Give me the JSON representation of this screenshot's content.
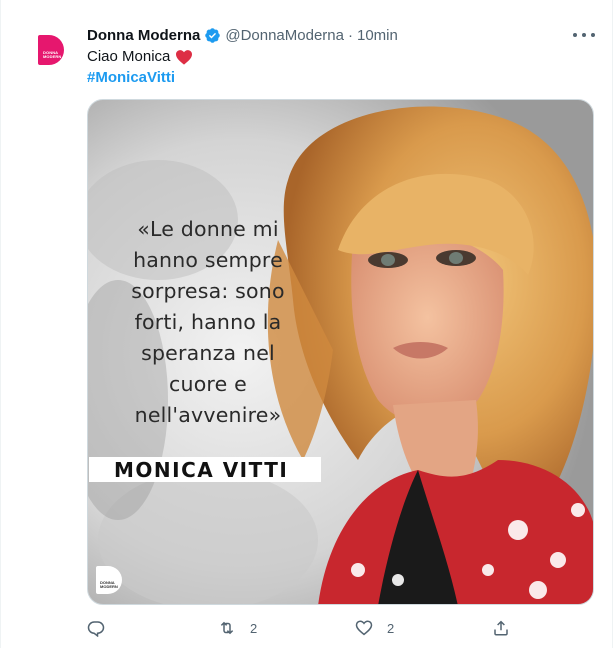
{
  "tweet": {
    "author_name": "Donna Moderna",
    "handle": "@DonnaModerna",
    "separator": "·",
    "time": "10min",
    "text": "Ciao Monica",
    "hashtag": "#MonicaVitti",
    "avatar_brand_text": "DONNA MODERNA",
    "accent_color": "#e6176e",
    "link_color": "#1d9bf0",
    "verified": true,
    "icons": {
      "verified": "verified-badge-icon",
      "heart_emoji": "red-heart-emoji",
      "more": "more-dots-icon",
      "reply": "reply-icon",
      "retweet": "retweet-icon",
      "like": "heart-outline-icon",
      "share": "share-icon"
    }
  },
  "media": {
    "quote_lines": [
      "«Le donne mi",
      "hanno sempre",
      "sorpresa: sono",
      "forti, hanno la",
      "speranza nel",
      "cuore e",
      "nell'avvenire»"
    ],
    "name": "MONICA VITTI",
    "logo_text": "DONNA MODERNA"
  },
  "actions": {
    "retweets": "2",
    "likes": "2"
  }
}
